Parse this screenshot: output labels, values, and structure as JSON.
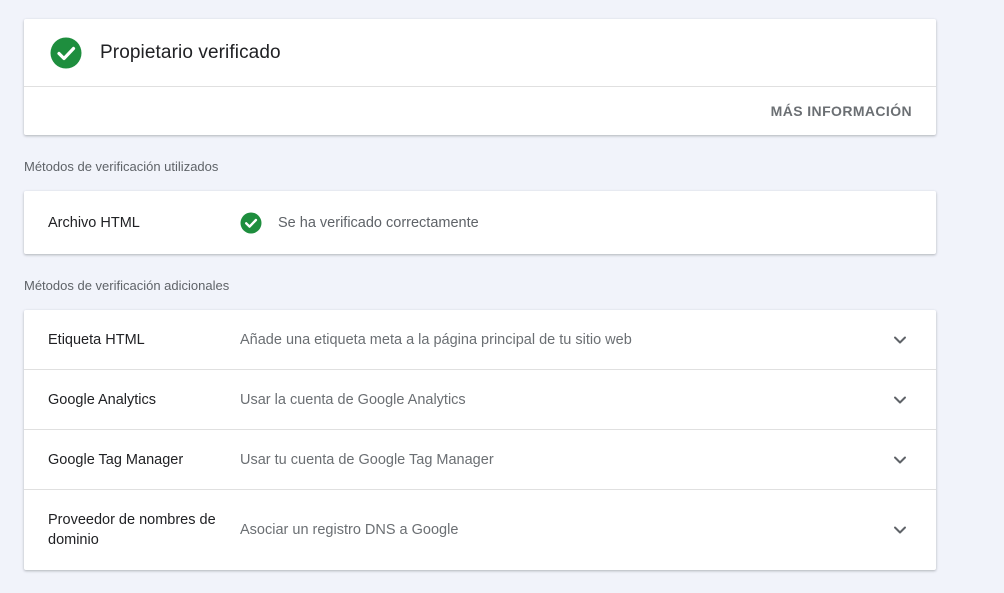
{
  "owner": {
    "title": "Propietario verificado",
    "more_info_label": "MÁS INFORMACIÓN",
    "icon": "check-circle-icon",
    "icon_color": "#1e8e3e"
  },
  "used_methods": {
    "label": "Métodos de verificación utilizados",
    "items": [
      {
        "name": "Archivo HTML",
        "status": "Se ha verificado correctamente",
        "icon": "check-circle-icon"
      }
    ]
  },
  "additional_methods": {
    "label": "Métodos de verificación adicionales",
    "items": [
      {
        "name": "Etiqueta HTML",
        "description": "Añade una etiqueta meta a la página principal de tu sitio web",
        "icon": "chevron-down-icon"
      },
      {
        "name": "Google Analytics",
        "description": "Usar la cuenta de Google Analytics",
        "icon": "chevron-down-icon"
      },
      {
        "name": "Google Tag Manager",
        "description": "Usar tu cuenta de Google Tag Manager",
        "icon": "chevron-down-icon"
      },
      {
        "name": "Proveedor de nombres de dominio",
        "description": "Asociar un registro DNS a Google",
        "icon": "chevron-down-icon"
      }
    ]
  },
  "colors": {
    "background": "#f1f3fa",
    "success_green": "#1e8e3e",
    "text_primary": "#202124",
    "text_secondary": "#5f6368"
  }
}
